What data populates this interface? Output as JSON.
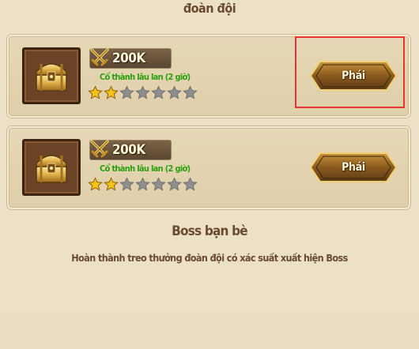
{
  "header": {
    "title": "đoàn đội"
  },
  "cards": [
    {
      "power": "200K",
      "location": "Cổ thành lâu lan (2 giờ)",
      "stars_filled": 2,
      "stars_total": 7,
      "button_label": "Phái",
      "chest_icon": "treasure-chest-icon",
      "power_icon": "crossed-swords-icon"
    },
    {
      "power": "200K",
      "location": "Cổ thành lâu lan (2 giờ)",
      "stars_filled": 2,
      "stars_total": 7,
      "button_label": "Phái",
      "chest_icon": "treasure-chest-icon",
      "power_icon": "crossed-swords-icon"
    }
  ],
  "boss_section": {
    "title": "Boss bạn bè",
    "description": "Hoàn thành treo thưởng đoàn đội có xác suất xuất hiện Boss"
  },
  "colors": {
    "background": "#ece0c6",
    "highlight": "#e8332e",
    "location_text": "#2f9a12",
    "star_filled": "#f5c21a",
    "star_empty": "#8f8f8f"
  }
}
